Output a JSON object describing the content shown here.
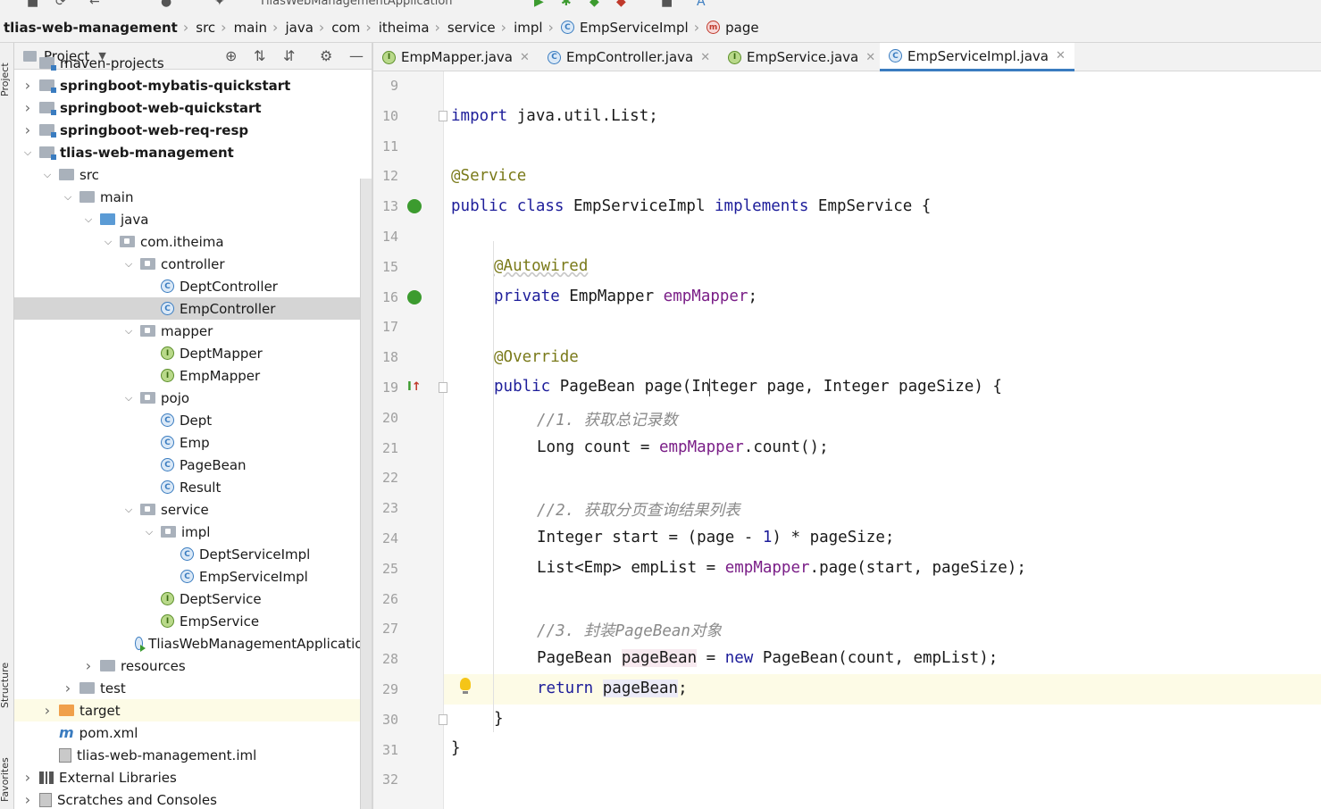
{
  "toolbar": {
    "run_config": "TliasWebManagementApplication"
  },
  "breadcrumb": {
    "items": [
      "tlias-web-management",
      "src",
      "main",
      "java",
      "com",
      "itheima",
      "service",
      "impl",
      "EmpServiceImpl",
      "page"
    ]
  },
  "sidebar_strip": {
    "project": "Project",
    "structure": "Structure",
    "favorites": "Favorites"
  },
  "project_panel": {
    "title": "Project",
    "tree": [
      {
        "label": "maven-projects",
        "level": 1,
        "icon": "folder-module-icon",
        "arrow": "none"
      },
      {
        "label": "springboot-mybatis-quickstart",
        "level": 1,
        "icon": "folder-module-icon",
        "arrow": "collapsed",
        "bold": true
      },
      {
        "label": "springboot-web-quickstart",
        "level": 1,
        "icon": "folder-module-icon",
        "arrow": "collapsed",
        "bold": true
      },
      {
        "label": "springboot-web-req-resp",
        "level": 1,
        "icon": "folder-module-icon",
        "arrow": "collapsed",
        "bold": true
      },
      {
        "label": "tlias-web-management",
        "level": 1,
        "icon": "folder-module-icon",
        "arrow": "expanded",
        "bold": true
      },
      {
        "label": "src",
        "level": 2,
        "icon": "folder-icon",
        "arrow": "expanded"
      },
      {
        "label": "main",
        "level": 3,
        "icon": "folder-icon",
        "arrow": "expanded"
      },
      {
        "label": "java",
        "level": 4,
        "icon": "folder-blue-icon",
        "arrow": "expanded"
      },
      {
        "label": "com.itheima",
        "level": 5,
        "icon": "package-icon",
        "arrow": "expanded"
      },
      {
        "label": "controller",
        "level": 6,
        "icon": "package-icon",
        "arrow": "expanded"
      },
      {
        "label": "DeptController",
        "level": 7,
        "icon": "class-icon",
        "arrow": "none"
      },
      {
        "label": "EmpController",
        "level": 7,
        "icon": "class-icon",
        "arrow": "none",
        "selected": true
      },
      {
        "label": "mapper",
        "level": 6,
        "icon": "package-icon",
        "arrow": "expanded"
      },
      {
        "label": "DeptMapper",
        "level": 7,
        "icon": "interface-icon",
        "arrow": "none"
      },
      {
        "label": "EmpMapper",
        "level": 7,
        "icon": "interface-icon",
        "arrow": "none"
      },
      {
        "label": "pojo",
        "level": 6,
        "icon": "package-icon",
        "arrow": "expanded"
      },
      {
        "label": "Dept",
        "level": 7,
        "icon": "class-icon",
        "arrow": "none"
      },
      {
        "label": "Emp",
        "level": 7,
        "icon": "class-icon",
        "arrow": "none"
      },
      {
        "label": "PageBean",
        "level": 7,
        "icon": "class-icon",
        "arrow": "none"
      },
      {
        "label": "Result",
        "level": 7,
        "icon": "class-icon",
        "arrow": "none"
      },
      {
        "label": "service",
        "level": 6,
        "icon": "package-icon",
        "arrow": "expanded"
      },
      {
        "label": "impl",
        "level": 7,
        "icon": "package-icon",
        "arrow": "expanded"
      },
      {
        "label": "DeptServiceImpl",
        "level": 8,
        "icon": "class-icon",
        "arrow": "none"
      },
      {
        "label": "EmpServiceImpl",
        "level": 8,
        "icon": "class-icon",
        "arrow": "none"
      },
      {
        "label": "DeptService",
        "level": 7,
        "icon": "interface-icon",
        "arrow": "none"
      },
      {
        "label": "EmpService",
        "level": 7,
        "icon": "interface-icon",
        "arrow": "none"
      },
      {
        "label": "TliasWebManagementApplication",
        "level": 6,
        "icon": "spring-app-icon",
        "arrow": "none"
      },
      {
        "label": "resources",
        "level": 4,
        "icon": "folder-icon",
        "arrow": "collapsed"
      },
      {
        "label": "test",
        "level": 3,
        "icon": "folder-icon",
        "arrow": "collapsed"
      },
      {
        "label": "target",
        "level": 2,
        "icon": "folder-orange-icon",
        "arrow": "collapsed",
        "highlight": true
      },
      {
        "label": "pom.xml",
        "level": 2,
        "icon": "maven-icon",
        "arrow": "none"
      },
      {
        "label": "tlias-web-management.iml",
        "level": 2,
        "icon": "iml-file-icon",
        "arrow": "none"
      },
      {
        "label": "External Libraries",
        "level": 1,
        "icon": "library-icon",
        "arrow": "collapsed"
      },
      {
        "label": "Scratches and Consoles",
        "level": 1,
        "icon": "scratches-icon",
        "arrow": "collapsed"
      }
    ]
  },
  "tabs": [
    {
      "label": "EmpMapper.java",
      "icon": "interface-icon",
      "active": false
    },
    {
      "label": "EmpController.java",
      "icon": "class-icon",
      "active": false
    },
    {
      "label": "EmpService.java",
      "icon": "interface-icon",
      "active": false
    },
    {
      "label": "EmpServiceImpl.java",
      "icon": "class-icon",
      "active": true
    }
  ],
  "editor": {
    "line_numbers": [
      "9",
      "10",
      "11",
      "12",
      "13",
      "14",
      "15",
      "16",
      "17",
      "18",
      "19",
      "20",
      "21",
      "22",
      "23",
      "24",
      "25",
      "26",
      "27",
      "28",
      "29",
      "30",
      "31",
      "32"
    ],
    "lines": {
      "l10_kw": "import",
      "l10_rest": " java.util.List;",
      "l12_ann": "@Service",
      "l13_kw1": "public class",
      "l13_name": " EmpServiceImpl ",
      "l13_kw2": "implements",
      "l13_rest": " EmpService {",
      "l15_ann": "@Autowired",
      "l16_kw": "private",
      "l16_type": " EmpMapper ",
      "l16_fld": "empMapper",
      "l16_end": ";",
      "l18_ann": "@Override",
      "l19_kw": "public",
      "l19_rest": " PageBean page(Integer page, Integer pageSize) {",
      "l20_cmt": "//1. 获取总记录数",
      "l21_a": "Long count = ",
      "l21_fld": "empMapper",
      "l21_b": ".count();",
      "l23_cmt": "//2. 获取分页查询结果列表",
      "l24_a": "Integer start = (page - ",
      "l24_num": "1",
      "l24_b": ") * pageSize;",
      "l25_a": "List<Emp> empList = ",
      "l25_fld": "empMapper",
      "l25_b": ".page(start, pageSize);",
      "l27_cmt": "//3. 封装PageBean对象",
      "l28_a": "PageBean ",
      "l28_hl": "pageBean",
      "l28_b": " = ",
      "l28_kw": "new",
      "l28_c": " PageBean(count, empList);",
      "l29_kw": "return",
      "l29_sp": " ",
      "l29_hl": "pageBean",
      "l29_end": ";",
      "l30": "}",
      "l31": "}"
    }
  }
}
